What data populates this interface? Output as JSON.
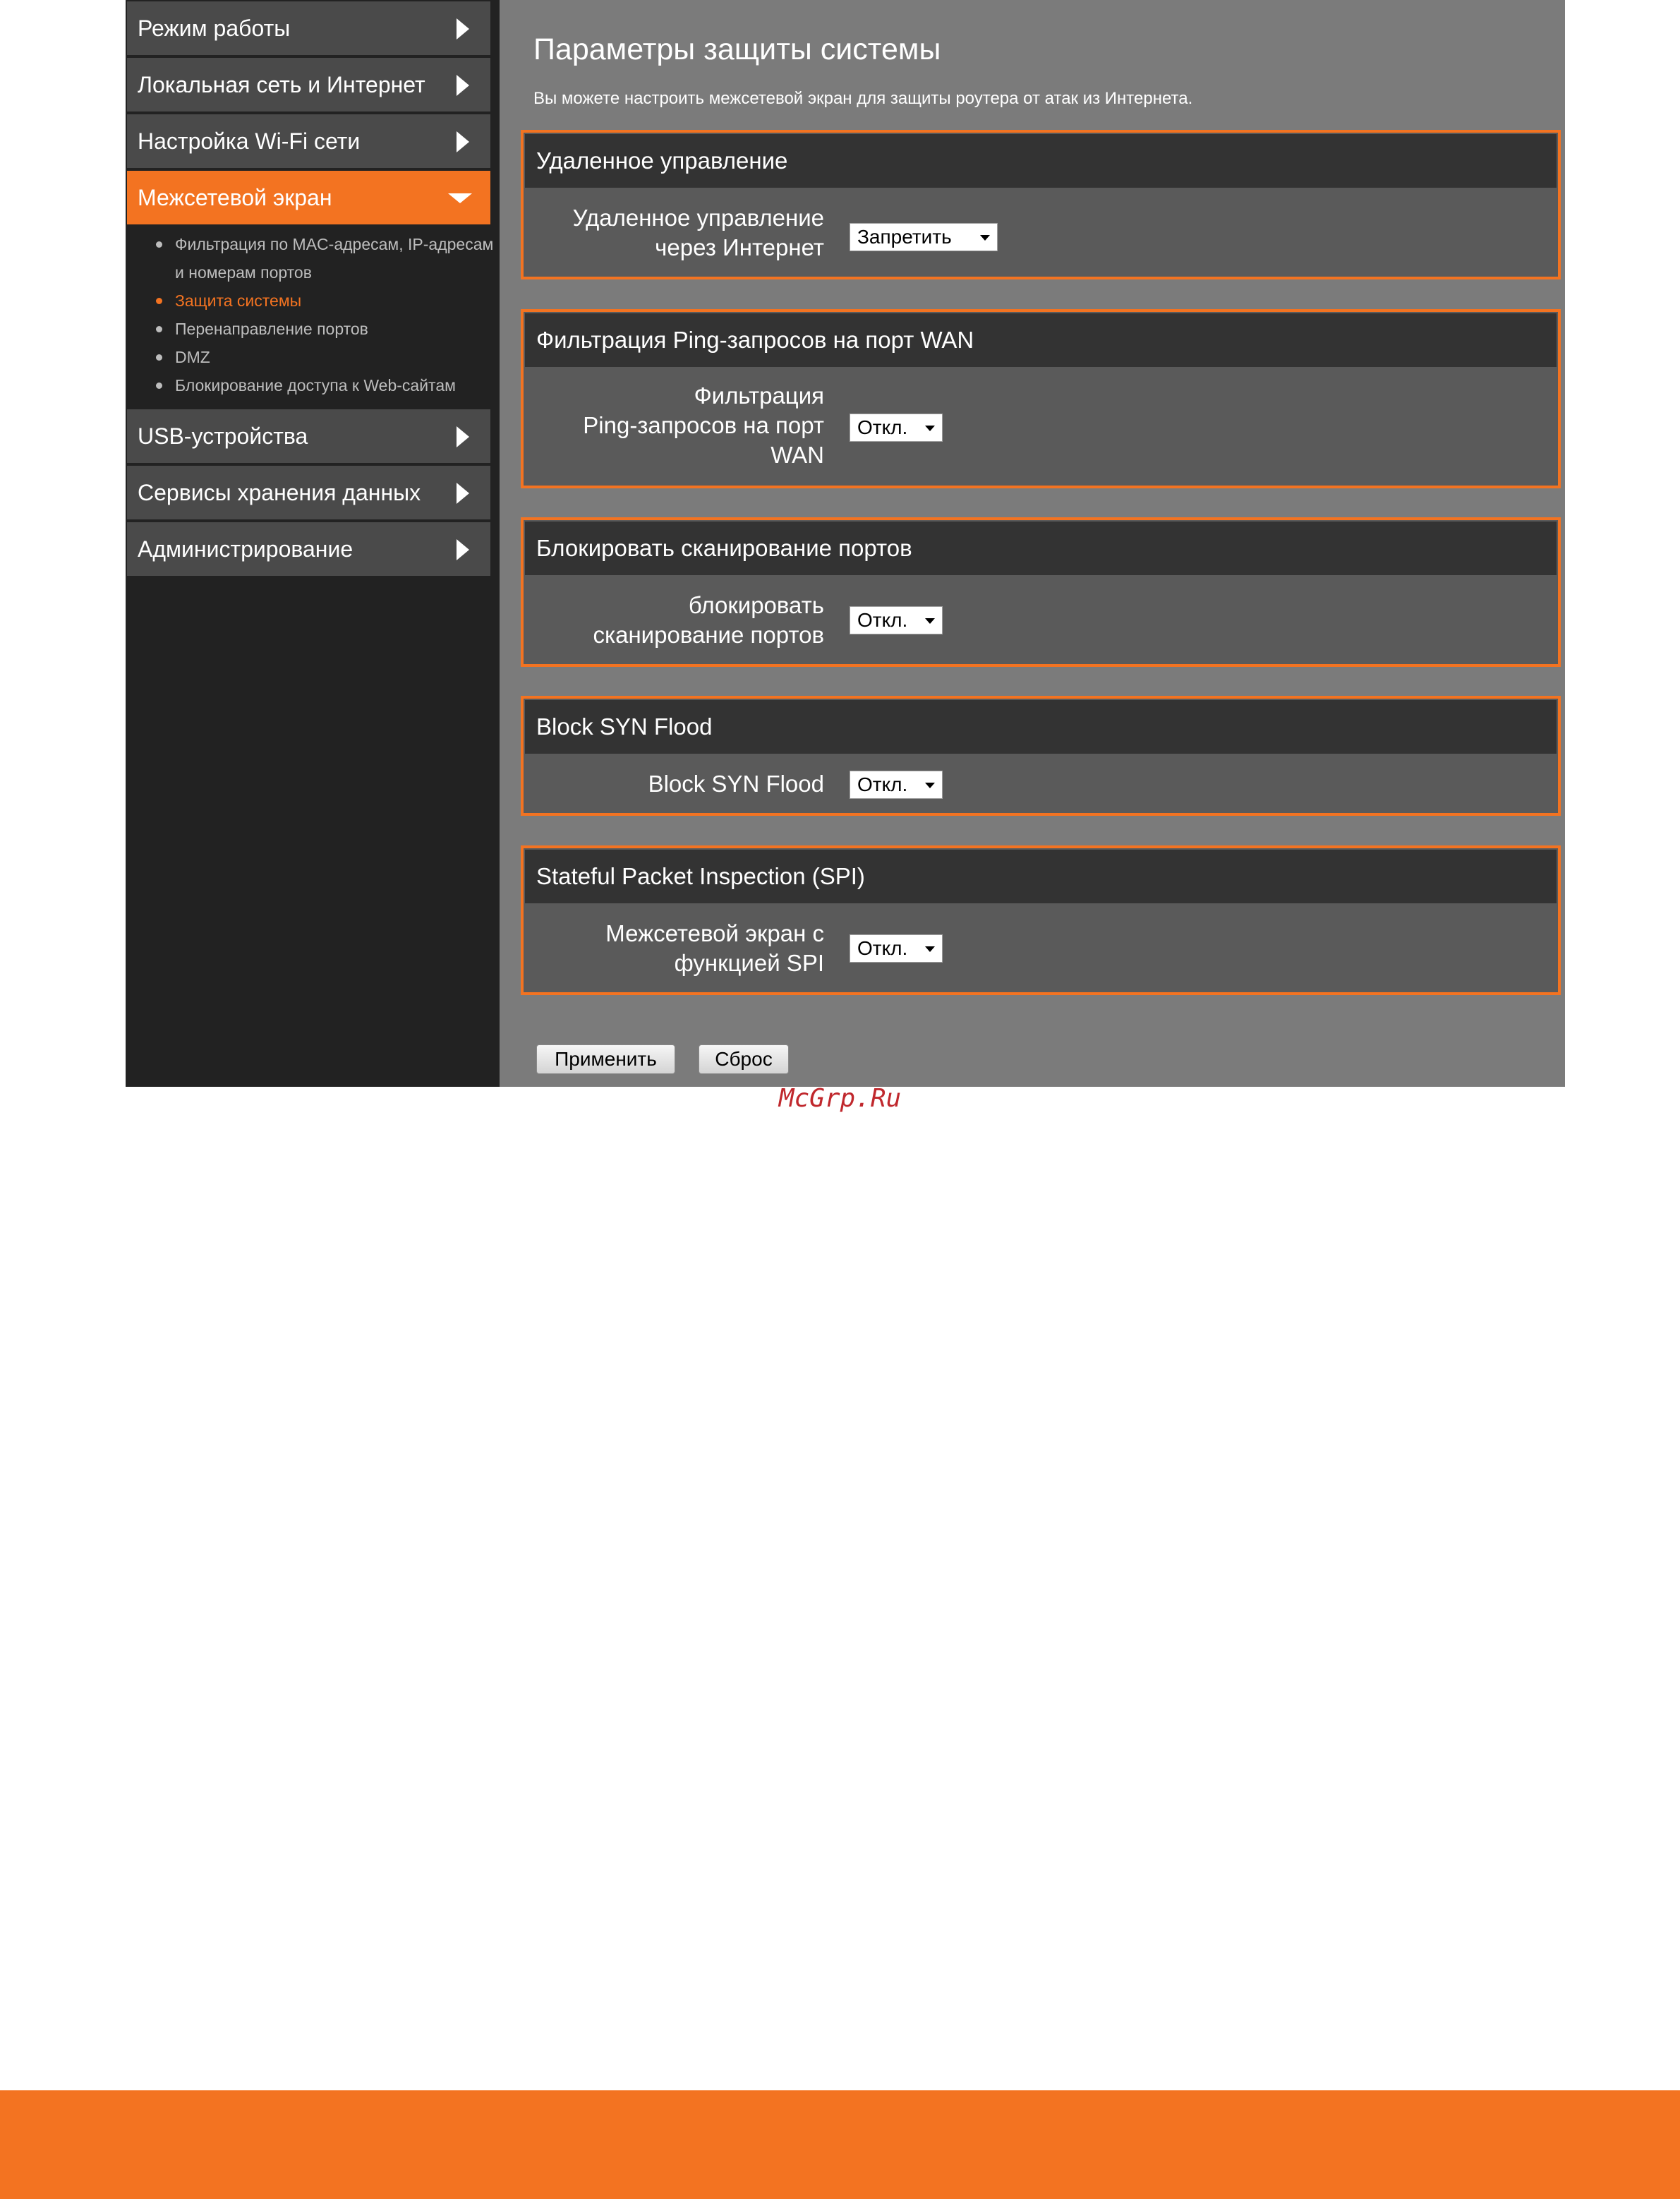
{
  "sidebar": {
    "items": [
      {
        "label": "Режим работы"
      },
      {
        "label": "Локальная сеть и Интернет"
      },
      {
        "label": "Настройка Wi-Fi сети"
      },
      {
        "label": "Межсетевой экран"
      },
      {
        "label": "USB-устройства"
      },
      {
        "label": "Сервисы хранения данных"
      },
      {
        "label": "Администрирование"
      }
    ],
    "subitems": [
      {
        "label": "Фильтрация по MAC-адресам, IP-адресам"
      },
      {
        "label": "и номерам портов"
      },
      {
        "label": "Защита системы"
      },
      {
        "label": "Перенаправление портов"
      },
      {
        "label": "DMZ"
      },
      {
        "label": "Блокирование доступа к Web-сайтам"
      }
    ]
  },
  "main": {
    "title": "Параметры защиты системы",
    "description": "Вы можете настроить межсетевой экран для защиты роутера от атак из Интернета.",
    "sections": [
      {
        "header": "Удаленное управление",
        "label_lines": [
          "Удаленное управление",
          "через Интернет"
        ],
        "value": "Запретить"
      },
      {
        "header": "Фильтрация Ping-запросов на порт WAN",
        "label_lines": [
          "Фильтрация",
          "Ping-запросов на порт",
          "WAN"
        ],
        "value": "Откл."
      },
      {
        "header": "Блокировать сканирование портов",
        "label_lines": [
          "блокировать",
          "сканирование портов"
        ],
        "value": "Откл."
      },
      {
        "header": "Block SYN Flood",
        "label_lines": [
          "Block SYN Flood"
        ],
        "value": "Откл."
      },
      {
        "header": "Stateful Packet Inspection (SPI)",
        "label_lines": [
          "Межсетевой экран с",
          "функцией SPI"
        ],
        "value": "Откл."
      }
    ],
    "buttons": {
      "apply": "Применить",
      "reset": "Сброс"
    }
  },
  "watermark": "McGrp.Ru",
  "colors": {
    "accent": "#f37321",
    "sidebar_bg": "#222222",
    "content_bg": "#7b7b7b",
    "panel_head": "#333333"
  }
}
